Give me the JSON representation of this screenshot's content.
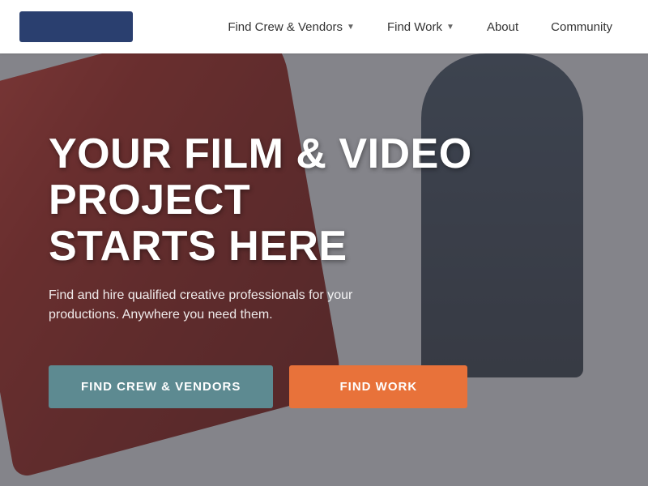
{
  "navbar": {
    "logo_alt": "Logo",
    "nav_items": [
      {
        "label": "Find Crew & Vendors",
        "has_dropdown": true
      },
      {
        "label": "Find Work",
        "has_dropdown": true
      },
      {
        "label": "About",
        "has_dropdown": false
      },
      {
        "label": "Community",
        "has_dropdown": false
      }
    ]
  },
  "hero": {
    "title_line1": "YOUR FILM & VIDEO PROJECT",
    "title_line2": "STARTS HERE",
    "subtitle": "Find and hire qualified creative professionals for your productions. Anywhere you need them.",
    "btn_crew_label": "FIND CREW & VENDORS",
    "btn_work_label": "FIND WORK"
  }
}
